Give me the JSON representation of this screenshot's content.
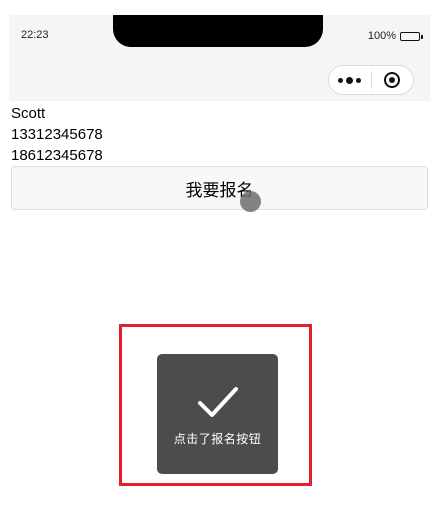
{
  "status_bar": {
    "time": "22:23",
    "battery": "100%"
  },
  "capsule": {
    "menu_icon": "more-dots-icon",
    "close_icon": "target-icon"
  },
  "content": {
    "lines": [
      "Scott",
      "13312345678",
      "18612345678"
    ],
    "signup_button_label": "我要报名"
  },
  "toast": {
    "icon": "check-icon",
    "message": "点击了报名按钮"
  },
  "colors": {
    "highlight_border": "#e0202a",
    "toast_background": "#4c4c4c",
    "navbar_background": "#f5f5f5"
  }
}
